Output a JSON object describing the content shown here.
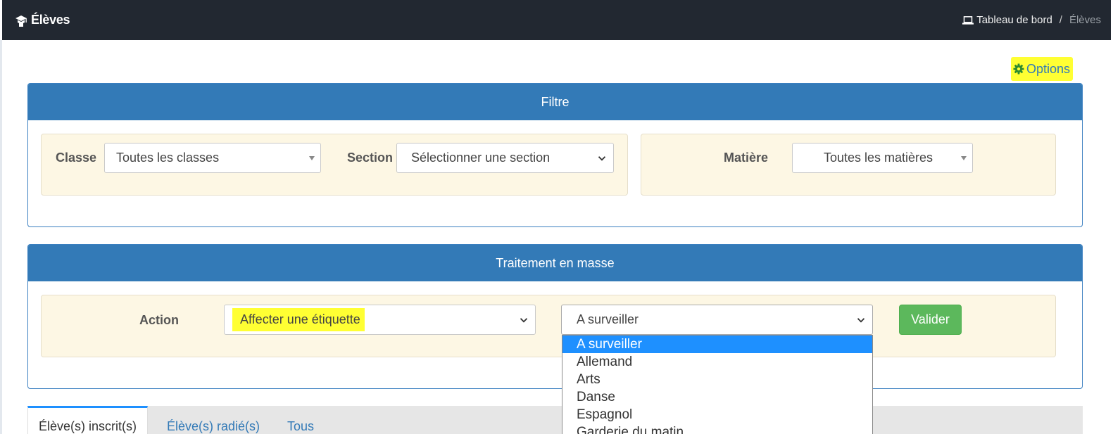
{
  "header": {
    "title": "Élèves",
    "breadcrumb": {
      "home_label": "Tableau de bord",
      "separator": "/",
      "current": "Élèves"
    }
  },
  "options_label": "Options",
  "filter_panel": {
    "title": "Filtre",
    "classe": {
      "label": "Classe",
      "value": "Toutes les classes"
    },
    "section": {
      "label": "Section",
      "value": "Sélectionner une section"
    },
    "matiere": {
      "label": "Matière",
      "value": "Toutes les matières"
    }
  },
  "mass_panel": {
    "title": "Traitement en masse",
    "action": {
      "label": "Action",
      "value": "Affecter une étiquette"
    },
    "tag": {
      "value": "A surveiller",
      "options": [
        "A surveiller",
        "Allemand",
        "Arts",
        "Danse",
        "Espagnol",
        "Garderie du matin"
      ]
    },
    "submit_label": "Valider"
  },
  "tabs": [
    {
      "label": "Élève(s) inscrit(s)",
      "active": true
    },
    {
      "label": "Élève(s) radié(s)",
      "active": false
    },
    {
      "label": "Tous",
      "active": false
    }
  ],
  "colors": {
    "topbar": "#222831",
    "panel_header": "#337ab7",
    "well": "#fdf7e4",
    "success": "#5cb85c",
    "highlight": "#ffff33",
    "selected_option": "#1e90ff"
  },
  "icons": {
    "brand": "student-icon",
    "home": "laptop-icon",
    "options": "gear-icon"
  }
}
